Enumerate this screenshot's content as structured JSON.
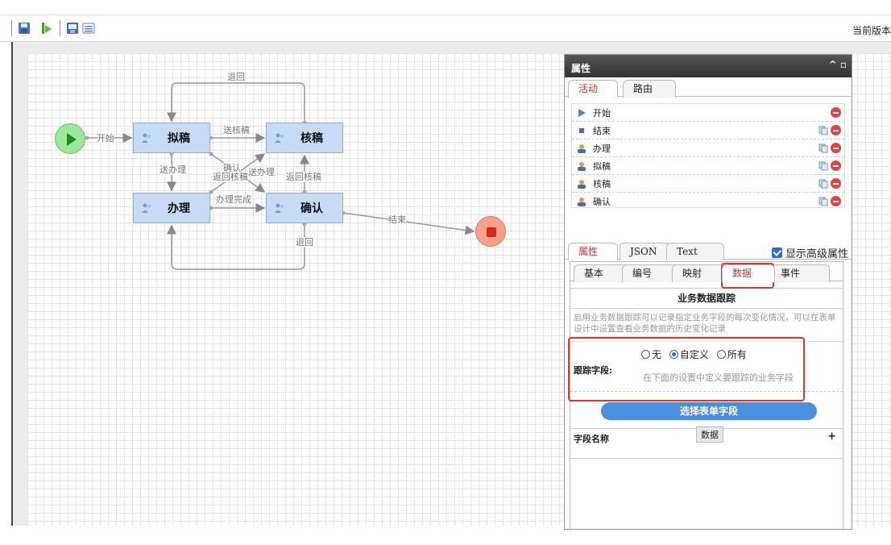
{
  "toolbar": {
    "version_text": "当前版本",
    "buttons": [
      "save-icon",
      "publish-icon",
      "export-icon",
      "list-icon"
    ]
  },
  "flow": {
    "nodes": {
      "draft": "拟稿",
      "review": "核稿",
      "handle": "办理",
      "confirm": "确认"
    },
    "edges": {
      "start": "开始",
      "send_review": "送核稿",
      "back_top": "退回",
      "send_handle": "送办理",
      "confirm_cross": "确认",
      "return_review_cross": "返回核稿",
      "send_handle_cross": "送办理",
      "return_review": "返回核稿",
      "handle_done": "办理完成",
      "back_bottom": "退回",
      "end": "结束"
    },
    "colors": {
      "node_fill": "#c6dcf6",
      "start": "#9be89b",
      "end": "#f7a08a"
    }
  },
  "panel": {
    "title": "属性",
    "controls": "^ ▫",
    "top_tabs": [
      "活动",
      "路由"
    ],
    "activities": [
      {
        "label": "开始",
        "icon": "play-icon",
        "copy": false
      },
      {
        "label": "结束",
        "icon": "stop-icon",
        "copy": true
      },
      {
        "label": "办理",
        "icon": "user-icon",
        "copy": true
      },
      {
        "label": "拟稿",
        "icon": "user-icon",
        "copy": true
      },
      {
        "label": "核稿",
        "icon": "user-icon",
        "copy": true
      },
      {
        "label": "确认",
        "icon": "user-icon",
        "copy": true
      }
    ],
    "prop_tabs": [
      "属性",
      "JSON",
      "Text"
    ],
    "advanced_label": "显示高级属性",
    "advanced_checked": true,
    "sub_tabs": [
      "基本",
      "编号",
      "映射",
      "数据",
      "事件"
    ],
    "active_sub_tab": "数据",
    "section_title": "业务数据跟踪",
    "description": "启用业务数据跟踪可以记录指定业务字段的每次变化情况，可以在表单设计中设置查看业务数据的历史变化记录",
    "track_label": "跟踪字段:",
    "radio_options": [
      "无",
      "自定义",
      "所有"
    ],
    "radio_selected": "自定义",
    "hint": "在下面的设置中定义要跟踪的业务字段",
    "pick_button": "选择表单字段",
    "field_header": "字段名称",
    "add_symbol": "+",
    "tooltip": "数据"
  }
}
